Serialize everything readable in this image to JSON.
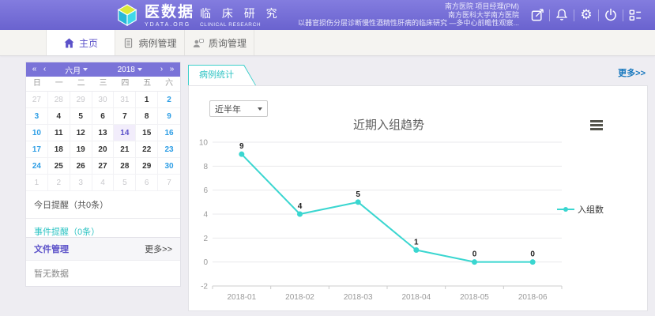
{
  "header": {
    "brand": {
      "name": "医数据",
      "domain": "YDATA.ORG",
      "subtitle_cn": "临 床 研 究",
      "subtitle_en": "CLINICAL RESEARCH"
    },
    "info_lines": [
      "南方医院  项目经理(PM)",
      "南方医科大学南方医院",
      "以器官损伤分层诊断慢性酒精性肝病的临床研究 —多中心前瞻性观察..."
    ]
  },
  "tabs": [
    {
      "label": "主页",
      "active": true
    },
    {
      "label": "病例管理",
      "active": false
    },
    {
      "label": "质询管理",
      "active": false
    }
  ],
  "calendar": {
    "nav": {
      "prev_year": "«",
      "prev_month": "‹",
      "month": "六月",
      "year": "2018",
      "next_month": "›",
      "next_year": "»"
    },
    "weekdays": [
      "日",
      "一",
      "二",
      "三",
      "四",
      "五",
      "六"
    ],
    "days": [
      {
        "d": "27",
        "t": "prev"
      },
      {
        "d": "28",
        "t": "prev"
      },
      {
        "d": "29",
        "t": "prev"
      },
      {
        "d": "30",
        "t": "prev"
      },
      {
        "d": "31",
        "t": "prev"
      },
      {
        "d": "1",
        "t": "day"
      },
      {
        "d": "2",
        "t": "weekend"
      },
      {
        "d": "3",
        "t": "weekend"
      },
      {
        "d": "4",
        "t": "day"
      },
      {
        "d": "5",
        "t": "day"
      },
      {
        "d": "6",
        "t": "day"
      },
      {
        "d": "7",
        "t": "day"
      },
      {
        "d": "8",
        "t": "day"
      },
      {
        "d": "9",
        "t": "weekend"
      },
      {
        "d": "10",
        "t": "weekend"
      },
      {
        "d": "11",
        "t": "day"
      },
      {
        "d": "12",
        "t": "day"
      },
      {
        "d": "13",
        "t": "day"
      },
      {
        "d": "14",
        "t": "today"
      },
      {
        "d": "15",
        "t": "day"
      },
      {
        "d": "16",
        "t": "weekend"
      },
      {
        "d": "17",
        "t": "weekend"
      },
      {
        "d": "18",
        "t": "day"
      },
      {
        "d": "19",
        "t": "day"
      },
      {
        "d": "20",
        "t": "day"
      },
      {
        "d": "21",
        "t": "day"
      },
      {
        "d": "22",
        "t": "day"
      },
      {
        "d": "23",
        "t": "weekend"
      },
      {
        "d": "24",
        "t": "weekend"
      },
      {
        "d": "25",
        "t": "day"
      },
      {
        "d": "26",
        "t": "day"
      },
      {
        "d": "27",
        "t": "day"
      },
      {
        "d": "28",
        "t": "day"
      },
      {
        "d": "29",
        "t": "day"
      },
      {
        "d": "30",
        "t": "weekend"
      },
      {
        "d": "1",
        "t": "next"
      },
      {
        "d": "2",
        "t": "next"
      },
      {
        "d": "3",
        "t": "next"
      },
      {
        "d": "4",
        "t": "next"
      },
      {
        "d": "5",
        "t": "next"
      },
      {
        "d": "6",
        "t": "next"
      },
      {
        "d": "7",
        "t": "next"
      }
    ],
    "today_date": "14"
  },
  "reminders": {
    "today": "今日提醒（共0条）",
    "event": "事件提醒（0条）"
  },
  "files": {
    "title": "文件管理",
    "more": "更多>>",
    "empty": "暂无数据"
  },
  "stats": {
    "tab": "病例统计",
    "more": "更多>>",
    "range": "近半年"
  },
  "chart_data": {
    "type": "line",
    "title": "近期入组趋势",
    "categories": [
      "2018-01",
      "2018-02",
      "2018-03",
      "2018-04",
      "2018-05",
      "2018-06"
    ],
    "series": [
      {
        "name": "入组数",
        "color": "#3ad6d0",
        "values": [
          9,
          4,
          5,
          1,
          0,
          0
        ]
      }
    ],
    "xlabel": "",
    "ylabel": "",
    "ylim": [
      -2,
      10
    ],
    "ytick_step": 2,
    "grid": true,
    "legend_position": "right"
  },
  "colors": {
    "header_purple": "#6a63cf",
    "calendar_purple": "#7a73d8",
    "accent_purple": "#5b51c9",
    "teal": "#2fc4c4",
    "weekend_blue": "#2e9ee5",
    "link_blue": "#1878be",
    "line_cyan": "#3ad6d0"
  }
}
